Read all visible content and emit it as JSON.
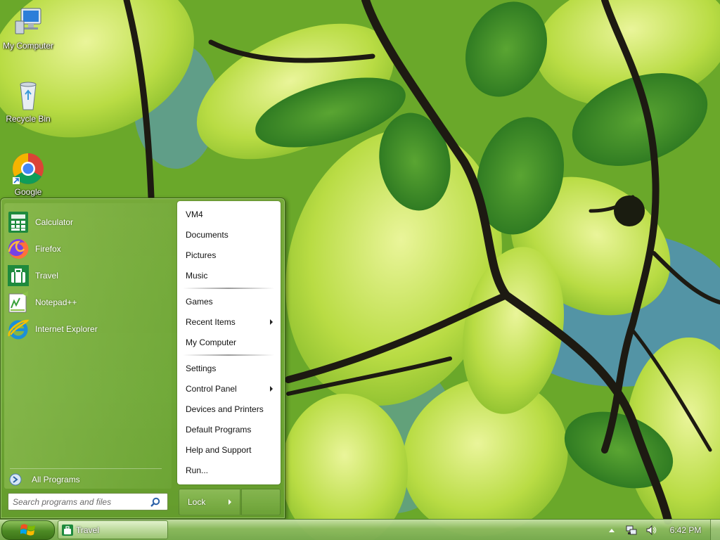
{
  "desktop": {
    "icons": [
      {
        "label": "My Computer",
        "icon": "computer-icon"
      },
      {
        "label": "Recycle Bin",
        "icon": "recycle-bin-icon"
      },
      {
        "label": "Google",
        "icon": "chrome-icon"
      }
    ]
  },
  "start_menu": {
    "programs": [
      {
        "label": "Calculator",
        "icon": "calculator-icon",
        "color": "#1e8a3d"
      },
      {
        "label": "Firefox",
        "icon": "firefox-icon",
        "color": "#e66000"
      },
      {
        "label": "Travel",
        "icon": "travel-icon",
        "color": "#1e8a3d"
      },
      {
        "label": "Notepad++",
        "icon": "notepad-plus-plus-icon",
        "color": "#8cc24a"
      },
      {
        "label": "Internet Explorer",
        "icon": "internet-explorer-icon",
        "color": "#1c8fd8"
      }
    ],
    "all_programs_label": "All Programs",
    "search": {
      "placeholder": "Search programs and files"
    },
    "right_items": [
      {
        "label": "VM4"
      },
      {
        "label": "Documents"
      },
      {
        "label": "Pictures"
      },
      {
        "label": "Music"
      },
      {
        "label": "Games"
      },
      {
        "label": "Recent Items",
        "submenu": true
      },
      {
        "label": "My Computer"
      },
      {
        "label": "Settings"
      },
      {
        "label": "Control Panel",
        "submenu": true
      },
      {
        "label": "Devices and Printers"
      },
      {
        "label": "Default Programs"
      },
      {
        "label": "Help and Support"
      },
      {
        "label": "Run..."
      }
    ],
    "lock_label": "Lock"
  },
  "taskbar": {
    "apps": [
      {
        "label": "Travel",
        "icon": "travel-icon"
      }
    ],
    "tray_icons": [
      "show-hidden-icons-icon",
      "network-icon",
      "volume-icon"
    ],
    "clock": "6:42 PM"
  }
}
